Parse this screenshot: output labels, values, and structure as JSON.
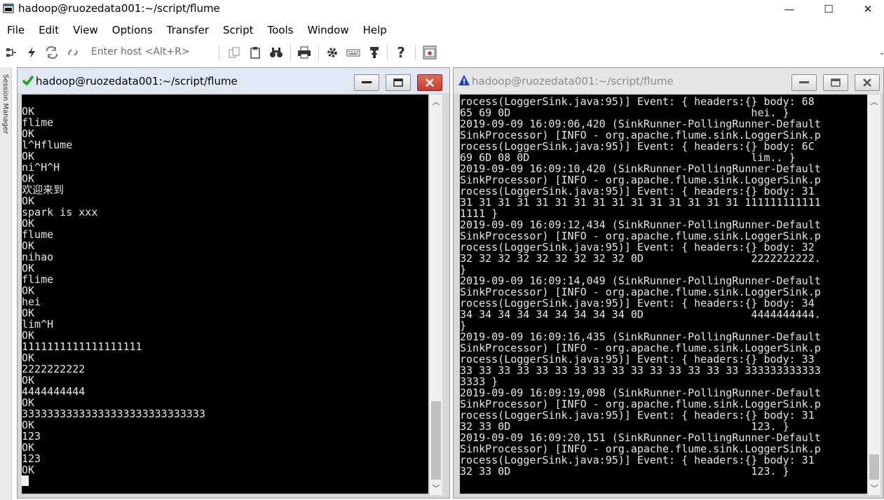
{
  "window": {
    "title": "hadoop@ruozedata001:~/script/flume",
    "minimize_glyph": "—",
    "maximize_glyph": "☐",
    "close_glyph": "✕"
  },
  "menu": [
    "File",
    "Edit",
    "View",
    "Options",
    "Transfer",
    "Script",
    "Tools",
    "Window",
    "Help"
  ],
  "toolbar": {
    "host_placeholder": "Enter host <Alt+R>",
    "icons": [
      "connect-icon",
      "quick-connect-icon",
      "reconnect-icon",
      "disconnect-icon",
      "copy-icon",
      "paste-icon",
      "find-icon",
      "print-icon",
      "settings-icon",
      "keymap-icon",
      "sftp-icon",
      "help-icon",
      "session-options-icon"
    ]
  },
  "session_manager": {
    "label": "Session Manager"
  },
  "left_pane": {
    "title": "hadoop@ruozedata001:~/script/flume",
    "status_color": "#1aa51a",
    "lines": [
      "OK",
      "flime",
      "OK",
      "l^Hflume",
      "OK",
      "ni^H^H",
      "OK",
      "欢迎来到",
      "OK",
      "spark is xxx",
      "OK",
      "flume",
      "OK",
      "nihao",
      "OK",
      "flime",
      "OK",
      "hei",
      "OK",
      "lim^H",
      "OK",
      "1111111111111111111",
      "OK",
      "2222222222",
      "OK",
      "4444444444",
      "OK",
      "33333333333333333333333333333",
      "OK",
      "123",
      "OK",
      "123",
      "OK"
    ]
  },
  "right_pane": {
    "title": "hadoop@ruozedata001:~/script/flume",
    "status_color": "#1d3fd6",
    "lines": [
      "rocess(LoggerSink.java:95)] Event: { headers:{} body: 68",
      "65 69 0D                                      hei. }",
      "2019-09-09 16:09:06,420 (SinkRunner-PollingRunner-Default",
      "SinkProcessor) [INFO - org.apache.flume.sink.LoggerSink.p",
      "rocess(LoggerSink.java:95)] Event: { headers:{} body: 6C",
      "69 6D 08 0D                                   lim.. }",
      "2019-09-09 16:09:10,420 (SinkRunner-PollingRunner-Default",
      "SinkProcessor) [INFO - org.apache.flume.sink.LoggerSink.p",
      "rocess(LoggerSink.java:95)] Event: { headers:{} body: 31",
      "31 31 31 31 31 31 31 31 31 31 31 31 31 31 31 111111111111",
      "1111 }",
      "2019-09-09 16:09:12,434 (SinkRunner-PollingRunner-Default",
      "SinkProcessor) [INFO - org.apache.flume.sink.LoggerSink.p",
      "rocess(LoggerSink.java:95)] Event: { headers:{} body: 32",
      "32 32 32 32 32 32 32 32 32 0D                 2222222222.",
      "}",
      "2019-09-09 16:09:14,049 (SinkRunner-PollingRunner-Default",
      "SinkProcessor) [INFO - org.apache.flume.sink.LoggerSink.p",
      "rocess(LoggerSink.java:95)] Event: { headers:{} body: 34",
      "34 34 34 34 34 34 34 34 34 0D                 4444444444.",
      "}",
      "2019-09-09 16:09:16,435 (SinkRunner-PollingRunner-Default",
      "SinkProcessor) [INFO - org.apache.flume.sink.LoggerSink.p",
      "rocess(LoggerSink.java:95)] Event: { headers:{} body: 33",
      "33 33 33 33 33 33 33 33 33 33 33 33 33 33 33 333333333333",
      "3333 }",
      "2019-09-09 16:09:19,098 (SinkRunner-PollingRunner-Default",
      "SinkProcessor) [INFO - org.apache.flume.sink.LoggerSink.p",
      "rocess(LoggerSink.java:95)] Event: { headers:{} body: 31",
      "32 33 0D                                      123. }",
      "2019-09-09 16:09:20,151 (SinkRunner-PollingRunner-Default",
      "SinkProcessor) [INFO - org.apache.flume.sink.LoggerSink.p",
      "rocess(LoggerSink.java:95)] Event: { headers:{} body: 31",
      "32 33 0D                                      123. }"
    ]
  }
}
